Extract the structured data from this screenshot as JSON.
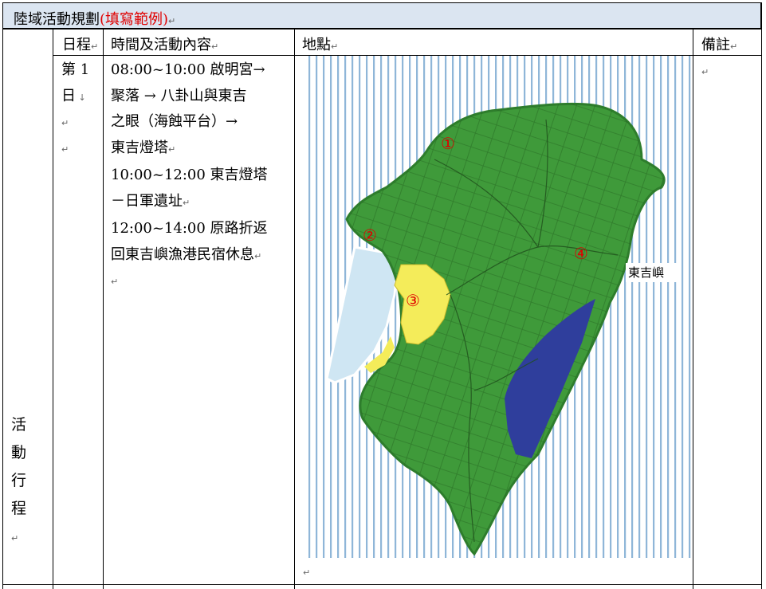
{
  "title": {
    "main": "陸域活動規劃",
    "example": "(填寫範例)"
  },
  "headers": {
    "day": "日程",
    "content": "時間及活動內容",
    "location": "地點",
    "remarks": "備註"
  },
  "row_label": "活動行程",
  "day": {
    "label_line1": "第 1",
    "label_line2": "日"
  },
  "content_lines": [
    "08:00~10:00  啟明宮→",
    "聚落  →  八卦山與東吉",
    "之眼（海蝕平台）→",
    "東吉燈塔",
    "10:00~12:00  東吉燈塔",
    "－日軍遺址",
    "12:00~14:00  原路折返",
    "回東吉嶼漁港民宿休息"
  ],
  "map": {
    "island_name": "東吉嶼",
    "markers": [
      "①",
      "②",
      "③",
      "④"
    ],
    "colors": {
      "land": "#3f9a3a",
      "land_dark": "#2e7d2c",
      "village": "#f4ec5a",
      "harbor": "#cfe6f3",
      "east_coast": "#2f3e9c",
      "sea_lines": "#8fb6d8",
      "marker": "#e00000"
    }
  },
  "colors": {
    "title_bg": "#dbe5f1",
    "title_red": "#e00000"
  }
}
